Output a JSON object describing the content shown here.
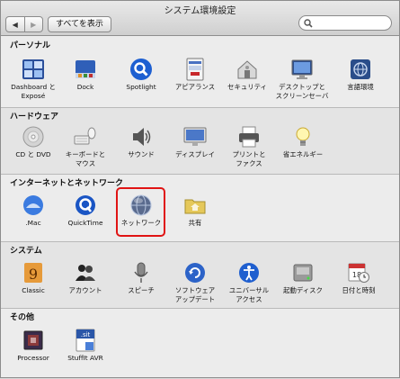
{
  "window": {
    "title": "システム環境設定"
  },
  "toolbar": {
    "back_glyph": "◀",
    "forward_glyph": "▶",
    "show_all": "すべてを表示",
    "search_placeholder": ""
  },
  "sections": {
    "personal": {
      "title": "パーソナル",
      "items": [
        {
          "label1": "Dashboard と",
          "label2": "Exposé",
          "icon": "dashboard-expose-icon"
        },
        {
          "label1": "Dock",
          "label2": "",
          "icon": "dock-icon"
        },
        {
          "label1": "Spotlight",
          "label2": "",
          "icon": "spotlight-icon"
        },
        {
          "label1": "アピアランス",
          "label2": "",
          "icon": "appearance-icon"
        },
        {
          "label1": "セキュリティ",
          "label2": "",
          "icon": "security-icon"
        },
        {
          "label1": "デスクトップと",
          "label2": "スクリーンセーバ",
          "icon": "desktop-screensaver-icon"
        },
        {
          "label1": "言語環境",
          "label2": "",
          "icon": "international-icon"
        }
      ]
    },
    "hardware": {
      "title": "ハードウェア",
      "items": [
        {
          "label1": "CD と DVD",
          "label2": "",
          "icon": "cd-dvd-icon"
        },
        {
          "label1": "キーボードと",
          "label2": "マウス",
          "icon": "keyboard-mouse-icon"
        },
        {
          "label1": "サウンド",
          "label2": "",
          "icon": "sound-icon"
        },
        {
          "label1": "ディスプレイ",
          "label2": "",
          "icon": "displays-icon"
        },
        {
          "label1": "プリントと",
          "label2": "ファクス",
          "icon": "print-fax-icon"
        },
        {
          "label1": "省エネルギー",
          "label2": "",
          "icon": "energy-saver-icon"
        }
      ]
    },
    "internet": {
      "title": "インターネットとネットワーク",
      "items": [
        {
          "label1": ".Mac",
          "label2": "",
          "icon": "dotmac-icon"
        },
        {
          "label1": "QuickTime",
          "label2": "",
          "icon": "quicktime-icon"
        },
        {
          "label1": "ネットワーク",
          "label2": "",
          "icon": "network-icon"
        },
        {
          "label1": "共有",
          "label2": "",
          "icon": "sharing-icon"
        }
      ]
    },
    "system": {
      "title": "システム",
      "items": [
        {
          "label1": "Classic",
          "label2": "",
          "icon": "classic-icon"
        },
        {
          "label1": "アカウント",
          "label2": "",
          "icon": "accounts-icon"
        },
        {
          "label1": "スピーチ",
          "label2": "",
          "icon": "speech-icon"
        },
        {
          "label1": "ソフトウェア",
          "label2": "アップデート",
          "icon": "software-update-icon"
        },
        {
          "label1": "ユニバーサル",
          "label2": "アクセス",
          "icon": "universal-access-icon"
        },
        {
          "label1": "起動ディスク",
          "label2": "",
          "icon": "startup-disk-icon"
        },
        {
          "label1": "日付と時刻",
          "label2": "",
          "icon": "date-time-icon"
        }
      ]
    },
    "other": {
      "title": "その他",
      "items": [
        {
          "label1": "Processor",
          "label2": "",
          "icon": "processor-icon"
        },
        {
          "label1": "StuffIt AVR",
          "label2": "",
          "icon": "stuffit-avr-icon"
        }
      ]
    }
  },
  "icon_texts": {
    "stuffit": ".sit",
    "date": "18"
  },
  "colors": {
    "highlight": "#e01414",
    "accent": "#1d5fd1"
  }
}
